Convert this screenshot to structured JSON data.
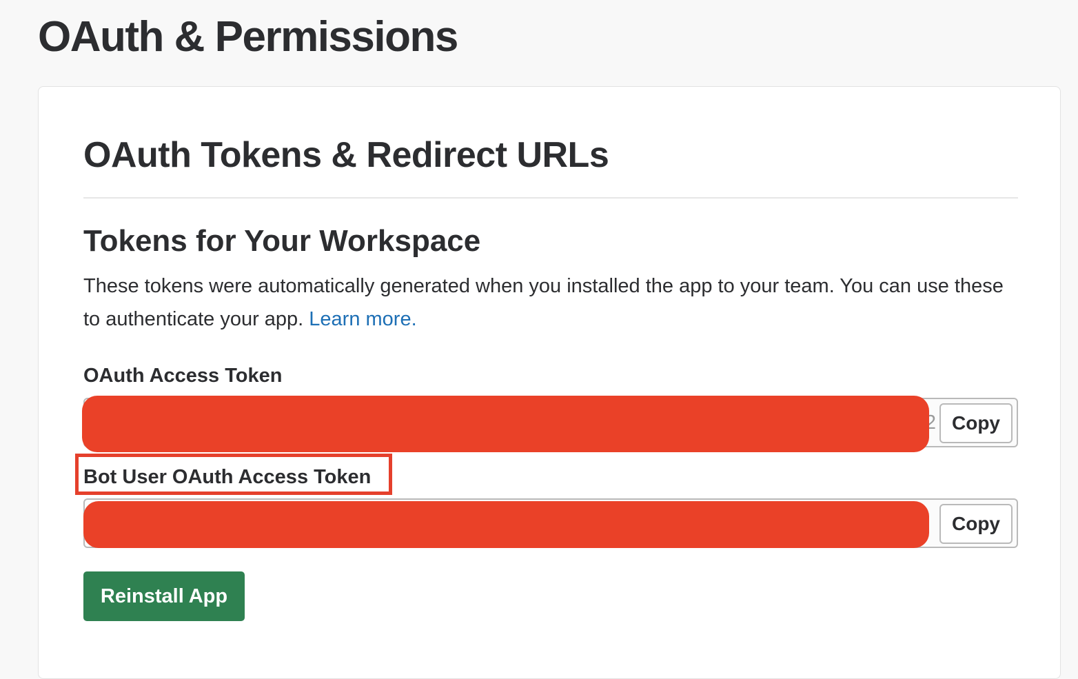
{
  "page": {
    "title": "OAuth & Permissions"
  },
  "card": {
    "section_title": "OAuth Tokens & Redirect URLs",
    "subsection_title": "Tokens for Your Workspace",
    "description": "These tokens were automatically generated when you installed the app to your team. You can use these to authenticate your app.",
    "learn_more_label": "Learn more.",
    "oauth_token": {
      "label": "OAuth Access Token",
      "visible_value_tail": "e2",
      "copy_label": "Copy"
    },
    "bot_token": {
      "label": "Bot User OAuth Access Token",
      "visible_value_tail": "",
      "copy_label": "Copy"
    },
    "reinstall_label": "Reinstall App"
  },
  "colors": {
    "redaction": "#ea4128",
    "highlight_box": "#e5402c",
    "reinstall_button": "#2f8151",
    "link": "#1d6fb5"
  }
}
